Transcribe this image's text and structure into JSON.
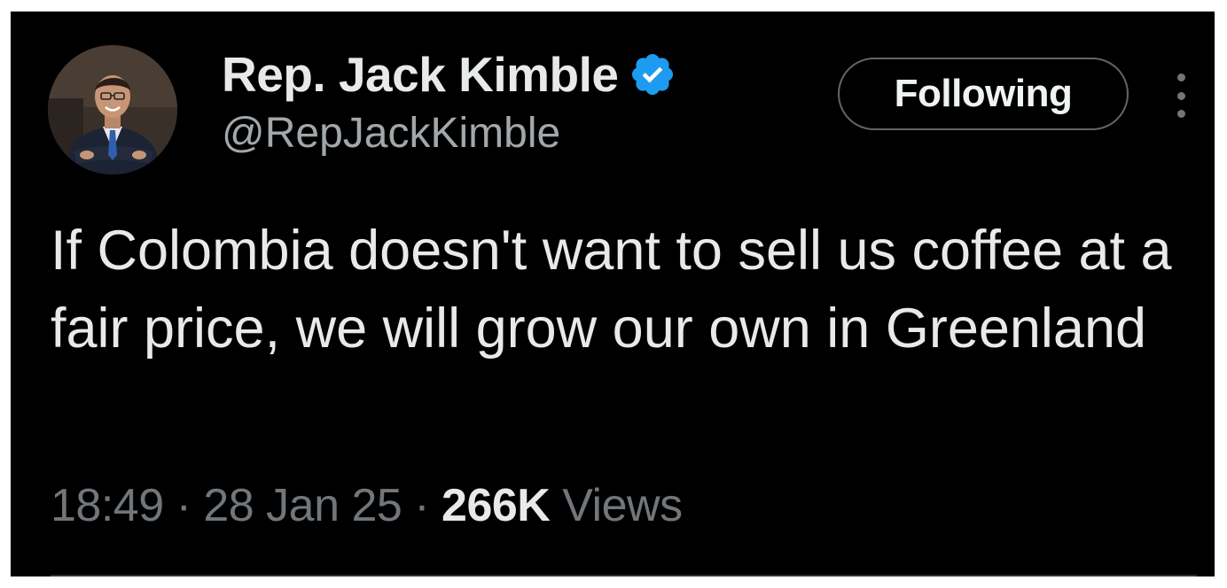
{
  "tweet": {
    "author": {
      "display_name": "Rep. Jack Kimble",
      "handle": "@RepJackKimble",
      "verified": true,
      "verified_color": "#1d9bf0"
    },
    "follow_button_label": "Following",
    "more_icon": "more-vertical-icon",
    "text": "If Colombia doesn't want to sell us coffee at a fair price, we will grow our own in Greenland",
    "meta": {
      "time": "18:49",
      "separator": "·",
      "date": "28 Jan 25",
      "views_count": "266K",
      "views_label": "Views"
    }
  },
  "colors": {
    "background": "#000000",
    "primary_text": "#e7e9ea",
    "secondary_text": "#71767b",
    "accent": "#1d9bf0"
  }
}
